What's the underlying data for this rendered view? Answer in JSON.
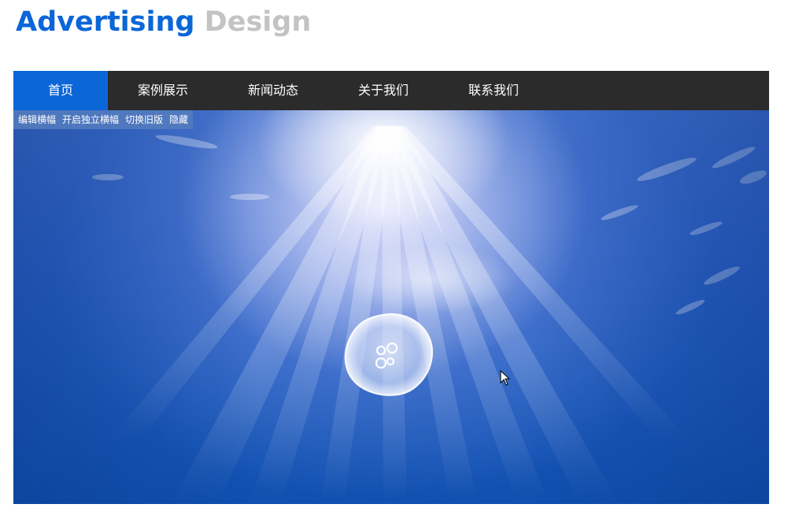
{
  "logo": {
    "primary": "Advertising",
    "secondary": "Design"
  },
  "nav": {
    "items": [
      {
        "label": "首页",
        "active": true
      },
      {
        "label": "案例展示"
      },
      {
        "label": "新闻动态"
      },
      {
        "label": "关于我们"
      },
      {
        "label": "联系我们"
      }
    ]
  },
  "banner": {
    "toolbar": [
      "编辑横幅",
      "开启独立横幅",
      "切换旧版",
      "隐藏"
    ]
  },
  "colors": {
    "accent": "#0b66d8",
    "nav_bg": "#2b2b2b",
    "logo_secondary": "#c3c3c3"
  }
}
